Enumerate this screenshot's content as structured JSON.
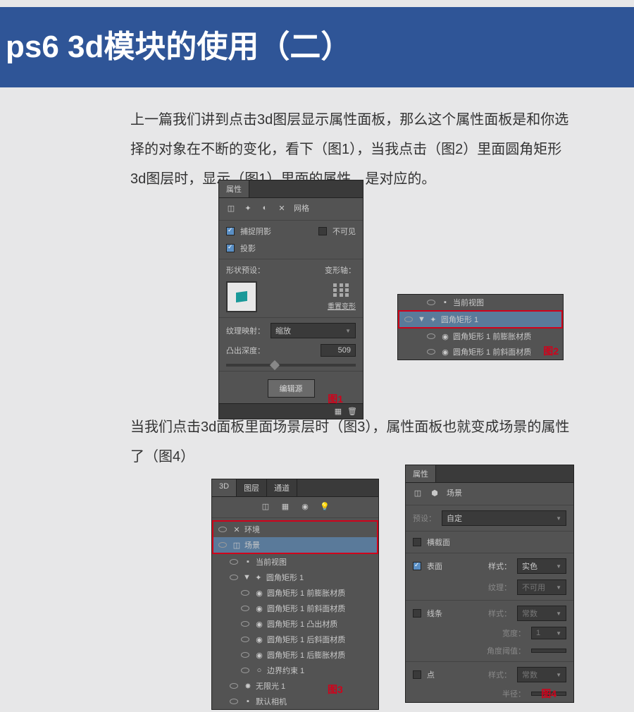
{
  "title": "ps6 3d模块的使用（二）",
  "para1": "上一篇我们讲到点击3d图层显示属性面板，那么这个属性面板是和你选择的对象在不断的变化，看下（图1），当我点击（图2）里面圆角矩形3d图层时，显示（图1）里面的属性，是对应的。",
  "para2": "当我们点击3d面板里面场景层时（图3），属性面板也就变成场景的属性了（图4）",
  "panel1": {
    "title": "属性",
    "mesh_label": "网格",
    "catch_shadow": "捕捉阴影",
    "invisible": "不可见",
    "cast_shadow": "投影",
    "shape_preset": "形状预设：",
    "deform_axis": "变形轴：",
    "reset_deform": "重置变形",
    "texture_map": "纹理映射：",
    "texture_val": "缩放",
    "extrude_depth": "凸出深度：",
    "depth_val": "509",
    "edit_source": "编辑源",
    "label": "图1"
  },
  "panel2": {
    "current_view": "当前视图",
    "rrect": "圆角矩形 1",
    "mat1": "圆角矩形 1 前膨胀材质",
    "mat2": "圆角矩形 1 前斜面材质",
    "label": "图2"
  },
  "panel3": {
    "tab1": "3D",
    "tab2": "图层",
    "tab3": "通道",
    "env": "环境",
    "scene": "场景",
    "current_view": "当前视图",
    "rrect": "圆角矩形 1",
    "mat1": "圆角矩形 1 前膨胀材质",
    "mat2": "圆角矩形 1 前斜面材质",
    "mat3": "圆角矩形 1 凸出材质",
    "mat4": "圆角矩形 1 后斜面材质",
    "mat5": "圆角矩形 1 后膨胀材质",
    "boundary": "边界约束 1",
    "infinite_light": "无限光 1",
    "default_camera": "默认相机",
    "label": "图3"
  },
  "panel4": {
    "title": "属性",
    "scene": "场景",
    "preset": "预设：",
    "preset_val": "自定",
    "cross_section": "横截面",
    "surface": "表面",
    "style": "样式：",
    "style_val": "实色",
    "texture": "纹理：",
    "texture_val": "不可用",
    "lines": "线条",
    "style2_val": "常数",
    "width": "宽度：",
    "width_val": "1",
    "angle_threshold": "角度阈值：",
    "points": "点",
    "style3_val": "常数",
    "radius": "半径：",
    "label": "图4"
  }
}
